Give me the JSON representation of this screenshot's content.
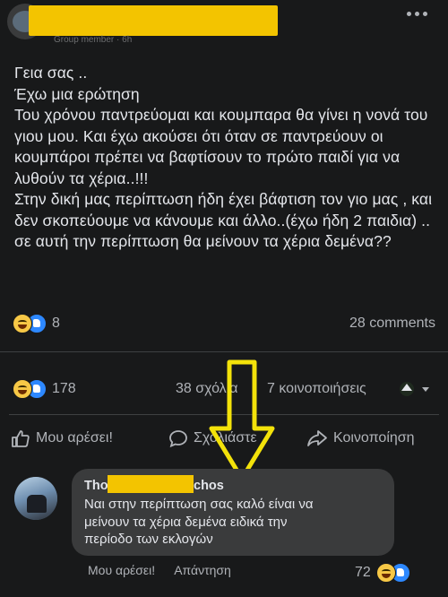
{
  "post": {
    "author_meta": "Group member · 6h",
    "body": "Γεια σας ..\nΈχω μια ερώτηση\nΤου χρόνου παντρεύομαι και κουμπαρα θα γίνει η νονά του γιου μου. Και έχω ακούσει ότι όταν σε παντρεύουν οι κουμπάροι πρέπει να βαφτίσουν το πρώτο παιδί για να λυθούν τα χέρια..!!!\nΣτην δική μας περίπτωση ήδη έχει βάφτιση τον γιο μας , και δεν σκοπεύουμε να κάνουμε και άλλο..(έχω ήδη 2 παιδια) ..  σε αυτή την περίπτωση θα μείνουν τα χέρια δεμένα??",
    "reaction_count": "8",
    "comments_count": "28 comments"
  },
  "share_post": {
    "reaction_count": "178",
    "comments": "38 σχόλια",
    "shares": "7 κοινοποιήσεις"
  },
  "actions": {
    "like": "Μου αρέσει!",
    "comment": "Σχολιάστε",
    "share": "Κοινοποίηση"
  },
  "comment": {
    "name_start": "Tho",
    "name_end": "chos",
    "text": "Ναι στην περίπτωση σας καλό είναι να\nμείνουν τα χέρια δεμένα ειδικά την\nπερίοδο των εκλογών",
    "like": "Μου αρέσει!",
    "reply": "Απάντηση",
    "reaction_count": "72"
  },
  "colors": {
    "background": "#18191a",
    "bubble": "#3a3b3c",
    "highlight": "#f3c400",
    "like_blue": "#2d88ff"
  }
}
